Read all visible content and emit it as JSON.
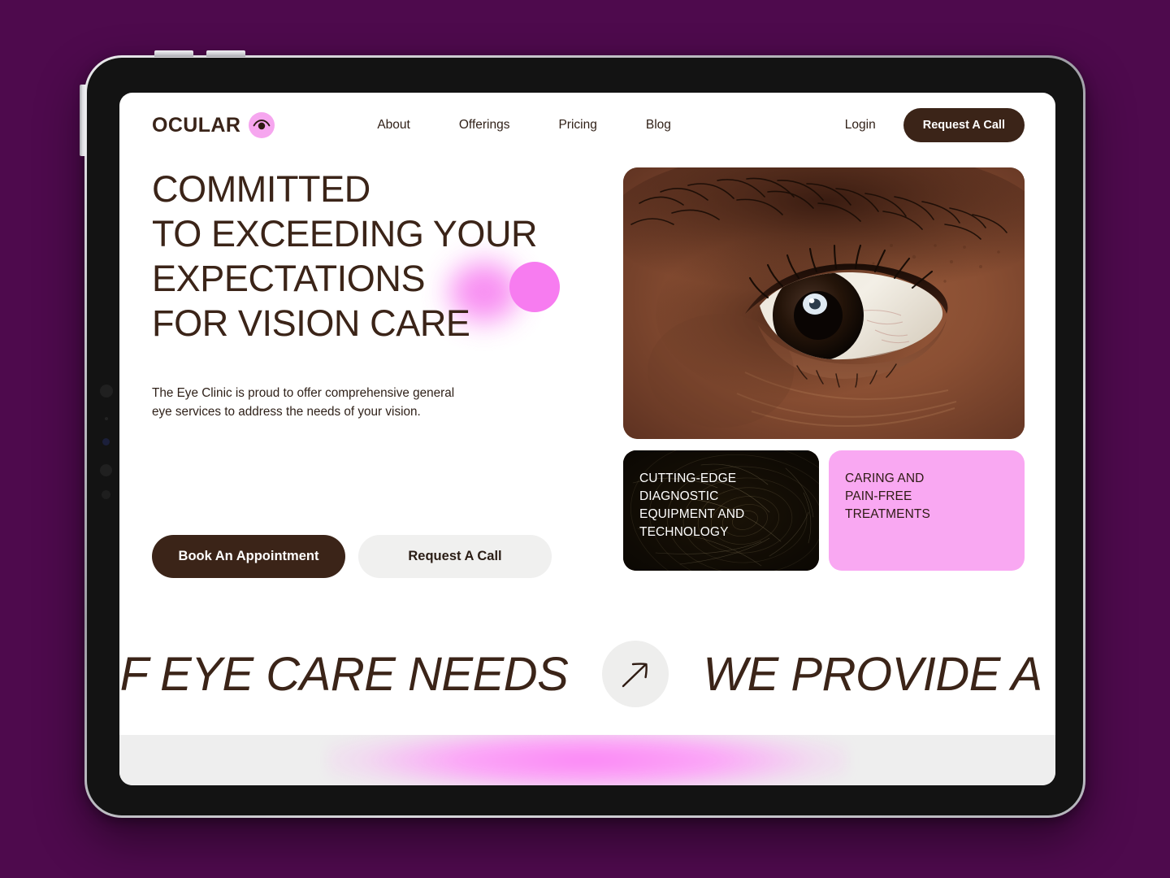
{
  "page": {
    "background_color": "#4e0a4d",
    "device": "tablet"
  },
  "theme": {
    "brand_dark": "#3b2418",
    "accent_pink": "#f77cf0",
    "card_pink": "#f9a8f2",
    "surface_light": "#f0f0ef",
    "screen_bg": "#ffffff"
  },
  "nav": {
    "brand": "OCULAR",
    "brand_icon": "eye-icon",
    "links": [
      {
        "label": "About"
      },
      {
        "label": "Offerings"
      },
      {
        "label": "Pricing"
      },
      {
        "label": "Blog"
      }
    ],
    "login_label": "Login",
    "cta_label": "Request A Call"
  },
  "hero": {
    "headline_lines": [
      "COMMITTED",
      "TO EXCEEDING YOUR",
      "EXPECTATIONS",
      "FOR VISION CARE"
    ],
    "subtext": "The Eye Clinic is proud to offer comprehensive general\neye services to address the needs  of your vision.",
    "primary_cta": "Book An Appointment",
    "secondary_cta": "Request A Call",
    "image_alt": "close-up-human-eye"
  },
  "feature_cards": [
    {
      "id": "cutting-edge",
      "text": "CUTTING-EDGE\nDIAGNOSTIC\nEQUIPMENT AND\nTECHNOLOGY",
      "style": "dark-texture"
    },
    {
      "id": "pain-free",
      "text": "CARING AND\nPAIN-FREE\nTREATMENTS",
      "style": "pink"
    }
  ],
  "marquee": {
    "text_left": "OF EYE CARE NEEDS",
    "text_right": "WE PROVIDE A",
    "arrow_icon": "arrow-up-right-icon"
  }
}
